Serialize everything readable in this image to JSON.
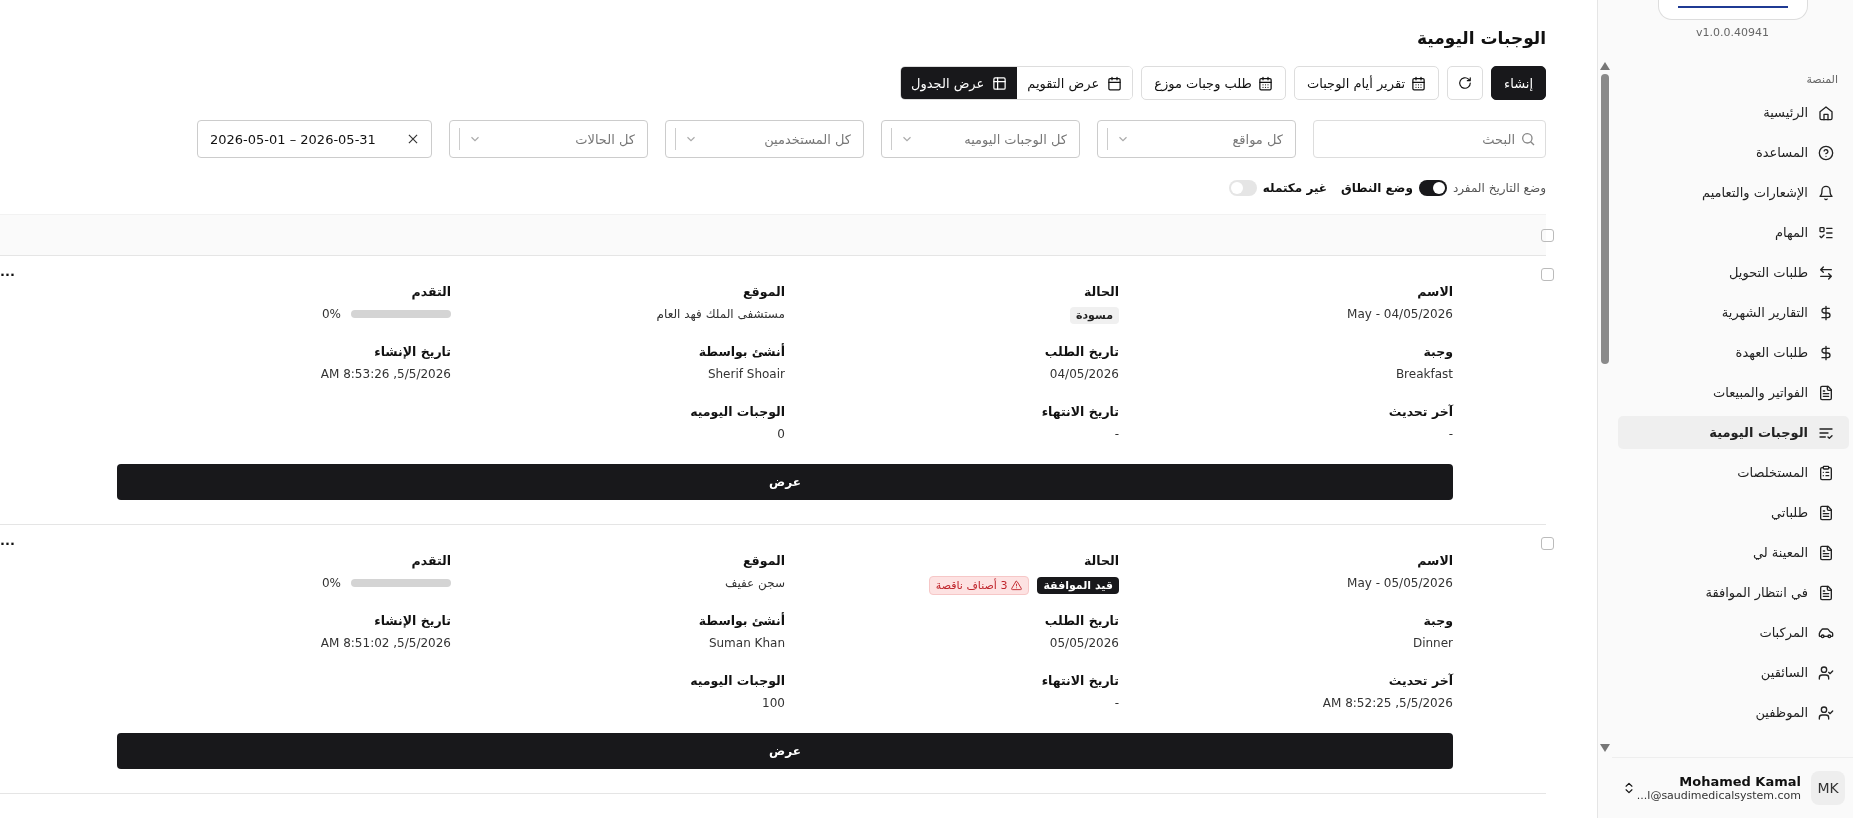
{
  "page": {
    "title": "الوجبات اليومية",
    "actions": [
      {
        "kind": "primary",
        "label": "إنشاء"
      },
      {
        "kind": "refresh"
      },
      {
        "kind": "outline",
        "label": "تقرير أيام الوجبات"
      },
      {
        "kind": "outline",
        "label": "طلب وجبات موزع"
      }
    ],
    "views": [
      {
        "label": "عرض التقويم",
        "selected": false
      },
      {
        "label": "عرض الجدول",
        "selected": true
      }
    ],
    "search": {
      "placeholder": "البحث"
    },
    "selects": [
      {
        "placeholder": "كل مواقع"
      },
      {
        "placeholder": "كل الوجبات اليوميه"
      },
      {
        "placeholder": "كل المستخدمين"
      },
      {
        "placeholder": "كل الحالات"
      }
    ],
    "date_range": {
      "value": "2026-05-01 – 2026-05-31"
    },
    "date_mode": {
      "single_label": "وضع التاريخ المفرد",
      "range_label": "وضع النطاق",
      "on": true
    },
    "incomplete": {
      "label": "غير مكتمله",
      "on": false
    }
  },
  "table": {
    "select_all": {
      "checked": false
    },
    "rows": [
      {
        "checked": false,
        "menu": "...",
        "button": "عرض",
        "fields": [
          {
            "kind": "text",
            "label": "الاسم",
            "value": "04/05/2026 - May"
          },
          {
            "kind": "status",
            "label": "الحالة",
            "badges": [
              {
                "kind": "draft",
                "text": "مسودة"
              }
            ]
          },
          {
            "kind": "text",
            "label": "الموقع",
            "value": "مستشفى الملك فهد العام"
          },
          {
            "kind": "progress",
            "label": "التقدم",
            "level": 0,
            "reading": "0%"
          },
          {
            "kind": "text",
            "label": "وجبة",
            "value": "Breakfast"
          },
          {
            "kind": "text",
            "label": "تاريخ الطلب",
            "value": "04/05/2026"
          },
          {
            "kind": "text",
            "label": "أنشئ بواسطة",
            "value": "Sherif Shoair"
          },
          {
            "kind": "text",
            "label": "تاريخ الإنشاء",
            "value": "5/5/2026, 8:53:26 AM"
          },
          {
            "kind": "text",
            "label": "آخر تحديث",
            "value": "-"
          },
          {
            "kind": "text",
            "label": "تاريخ الانتهاء",
            "value": "-"
          },
          {
            "kind": "text",
            "label": "الوجبات اليوميه",
            "value": "0"
          }
        ]
      },
      {
        "checked": false,
        "menu": "...",
        "button": "عرض",
        "fields": [
          {
            "kind": "text",
            "label": "الاسم",
            "value": "05/05/2026 - May"
          },
          {
            "kind": "status",
            "label": "الحالة",
            "badges": [
              {
                "kind": "pending",
                "text": "قيد الموافقة"
              },
              {
                "kind": "warning",
                "text": "3 أصناف ناقصة"
              }
            ]
          },
          {
            "kind": "text",
            "label": "الموقع",
            "value": "سجن عفيف"
          },
          {
            "kind": "progress",
            "label": "التقدم",
            "level": 0,
            "reading": "0%"
          },
          {
            "kind": "text",
            "label": "وجبة",
            "value": "Dinner"
          },
          {
            "kind": "text",
            "label": "تاريخ الطلب",
            "value": "05/05/2026"
          },
          {
            "kind": "text",
            "label": "أنشئ بواسطة",
            "value": "Suman Khan"
          },
          {
            "kind": "text",
            "label": "تاريخ الإنشاء",
            "value": "5/5/2026, 8:51:02 AM"
          },
          {
            "kind": "text",
            "label": "آخر تحديث",
            "value": "5/5/2026, 8:52:25 AM"
          },
          {
            "kind": "text",
            "label": "تاريخ الانتهاء",
            "value": "-"
          },
          {
            "kind": "text",
            "label": "الوجبات اليوميه",
            "value": "100"
          }
        ]
      }
    ]
  },
  "sidebar": {
    "version": "v1.0.0.40941",
    "section": "المنصة",
    "items": [
      {
        "label": "الرئيسية",
        "selected": false
      },
      {
        "label": "المساعدة",
        "selected": false
      },
      {
        "label": "الإشعارات والتعاميم",
        "selected": false
      },
      {
        "label": "المهام",
        "selected": false
      },
      {
        "label": "طلبات التحويل",
        "selected": false
      },
      {
        "label": "التقارير الشهرية",
        "selected": false
      },
      {
        "label": "طلبات العهدة",
        "selected": false
      },
      {
        "label": "الفواتير والمبيعات",
        "selected": false
      },
      {
        "label": "الوجبات اليومية",
        "selected": true
      },
      {
        "label": "المستخلصات",
        "selected": false
      },
      {
        "label": "طلباتي",
        "selected": false
      },
      {
        "label": "المعينة لي",
        "selected": false
      },
      {
        "label": "في انتظار الموافقة",
        "selected": false
      },
      {
        "label": "المركبات",
        "selected": false
      },
      {
        "label": "السائقين",
        "selected": false
      },
      {
        "label": "الموظفين",
        "selected": false
      }
    ],
    "user": {
      "name": "Mohamed Kamal",
      "email": "...l@saudimedicalsystem.com",
      "initials": "MK"
    }
  }
}
